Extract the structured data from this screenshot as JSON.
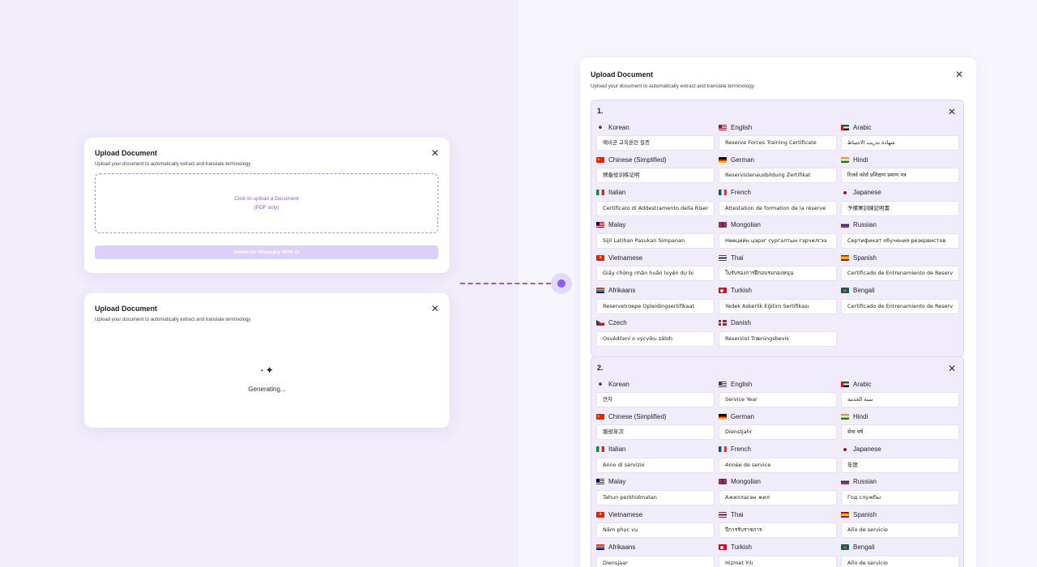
{
  "upload_card": {
    "title": "Upload Document",
    "subtitle": "Upload your document to automatically extract and translate terminology",
    "dropzone_line1": "Click to upload a Document",
    "dropzone_line2": "(PDF only)",
    "generate_button": "Generate Glossary With AI",
    "close_icon": "close-icon"
  },
  "generating_card": {
    "title": "Upload Document",
    "subtitle": "Upload your document to automatically extract and translate terminology",
    "status": "Generating...",
    "icon": "sparkle-icon"
  },
  "result_card": {
    "title": "Upload Document",
    "subtitle": "Upload your document to automatically extract and translate terminology",
    "entries": [
      {
        "number": "1.",
        "languages": [
          {
            "name": "Korean",
            "flag": "kr",
            "value": "예비군 교육훈련 필증"
          },
          {
            "name": "English",
            "flag": "us",
            "value": "Reserve Forces Training Certificate"
          },
          {
            "name": "Arabic",
            "flag": "ae",
            "value": "شهادة تدريب الاحتياط"
          },
          {
            "name": "Chinese (Simplified)",
            "flag": "cn",
            "value": "预备役训练证明"
          },
          {
            "name": "German",
            "flag": "de",
            "value": "Reservistenausbildung Zertifikat"
          },
          {
            "name": "Hindi",
            "flag": "in",
            "value": "रिजर्व फोर्स प्रशिक्षण प्रमाण पत्र"
          },
          {
            "name": "Italian",
            "flag": "it",
            "value": "Certificato di Addestramento della Riser"
          },
          {
            "name": "French",
            "flag": "fr",
            "value": "Attestation de formation de la réserve"
          },
          {
            "name": "Japanese",
            "flag": "jp",
            "value": "予備軍訓練証明書"
          },
          {
            "name": "Malay",
            "flag": "my",
            "value": "Sijil Latihan Pasukan Simpanan"
          },
          {
            "name": "Mongolian",
            "flag": "mn",
            "value": "Нөөцийн цэрэг сургалтын гэрчилгээ"
          },
          {
            "name": "Russian",
            "flag": "ru",
            "value": "Сертификат обучения резервистов"
          },
          {
            "name": "Vietnamese",
            "flag": "vn",
            "value": "Giấy chứng nhận huấn luyện dự bị"
          },
          {
            "name": "Thai",
            "flag": "th",
            "value": "ใบรับรองการฝึกอบรมกองหนุน"
          },
          {
            "name": "Spanish",
            "flag": "es",
            "value": "Certificado de Entrenamiento de Reserv"
          },
          {
            "name": "Afrikaans",
            "flag": "za",
            "value": "Reservetroepe Opleidingsertifikaat"
          },
          {
            "name": "Turkish",
            "flag": "tr",
            "value": "Yedek Askerlik Eğitim Sertifikası"
          },
          {
            "name": "Bengali",
            "flag": "bd",
            "value": "Certificado de Entrenamiento de Reserv"
          },
          {
            "name": "Czech",
            "flag": "cz",
            "value": "Osvědčení o výcviku záloh"
          },
          {
            "name": "Danish",
            "flag": "dk",
            "value": "Reservist Træningsbevis"
          }
        ]
      },
      {
        "number": "2.",
        "languages": [
          {
            "name": "Korean",
            "flag": "kr",
            "value": "연차"
          },
          {
            "name": "English",
            "flag": "us",
            "value": "Service Year"
          },
          {
            "name": "Arabic",
            "flag": "ae",
            "value": "سنة الخدمة"
          },
          {
            "name": "Chinese (Simplified)",
            "flag": "cn",
            "value": "服役年次"
          },
          {
            "name": "German",
            "flag": "de",
            "value": "Dienstjahr"
          },
          {
            "name": "Hindi",
            "flag": "in",
            "value": "सेवा वर्ष"
          },
          {
            "name": "Italian",
            "flag": "it",
            "value": "Anno di servizio"
          },
          {
            "name": "French",
            "flag": "fr",
            "value": "Année de service"
          },
          {
            "name": "Japanese",
            "flag": "jp",
            "value": "年度"
          },
          {
            "name": "Malay",
            "flag": "my",
            "value": "Tahun perkhidmatan"
          },
          {
            "name": "Mongolian",
            "flag": "mn",
            "value": "Ажилласан жил"
          },
          {
            "name": "Russian",
            "flag": "ru",
            "value": "Год службы"
          },
          {
            "name": "Vietnamese",
            "flag": "vn",
            "value": "Năm phục vụ"
          },
          {
            "name": "Thai",
            "flag": "th",
            "value": "ปีการรับราชการ"
          },
          {
            "name": "Spanish",
            "flag": "es",
            "value": "Año de servicio"
          },
          {
            "name": "Afrikaans",
            "flag": "za",
            "value": "Diensjaar"
          },
          {
            "name": "Turkish",
            "flag": "tr",
            "value": "Hizmet Yılı"
          },
          {
            "name": "Bengali",
            "flag": "bd",
            "value": "Año de servicio"
          }
        ]
      }
    ]
  },
  "colors": {
    "accent": "#8b5cf6",
    "accent_light": "#dcd0fa",
    "entry_bg": "#f1ecfc"
  }
}
